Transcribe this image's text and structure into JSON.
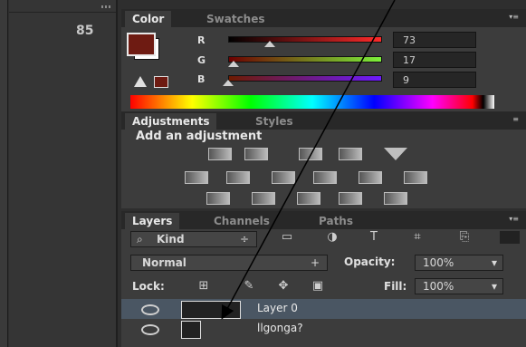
{
  "colors": {
    "foreground": "#6e1b12",
    "background": "#ffffff",
    "panel": "#3c3c3c",
    "tabbar": "#282828",
    "arrow": "#000000"
  },
  "toolcol": {
    "glyph": "85"
  },
  "color_panel": {
    "tabs": [
      "Color",
      "Swatches"
    ],
    "sliders": [
      {
        "label": "R",
        "value": "73"
      },
      {
        "label": "G",
        "value": "17"
      },
      {
        "label": "B",
        "value": "9"
      }
    ]
  },
  "adjustments": {
    "tabs": [
      "Adjustments",
      "Styles"
    ],
    "title": "Add an adjustment",
    "icons": [
      "brightness-contrast-icon",
      "levels-icon",
      "curves-icon",
      "exposure-icon",
      "triangle-icon",
      "vibrance-icon",
      "hue-saturation-icon",
      "color-balance-icon",
      "black-white-icon",
      "photo-filter-icon",
      "channel-mixer-icon",
      "invert-icon",
      "posterize-icon",
      "threshold-icon",
      "selective-color-icon",
      "gradient-map-icon"
    ]
  },
  "layers": {
    "tabs": [
      "Layers",
      "Channels",
      "Paths"
    ],
    "kind_label": "Kind",
    "blend_mode": "Normal",
    "opacity_label": "Opacity:",
    "opacity_value": "100%",
    "lock_label": "Lock:",
    "fill_label": "Fill:",
    "fill_value": "100%",
    "items": [
      {
        "name": "Layer 0"
      },
      {
        "name": "llgonga?"
      }
    ]
  }
}
